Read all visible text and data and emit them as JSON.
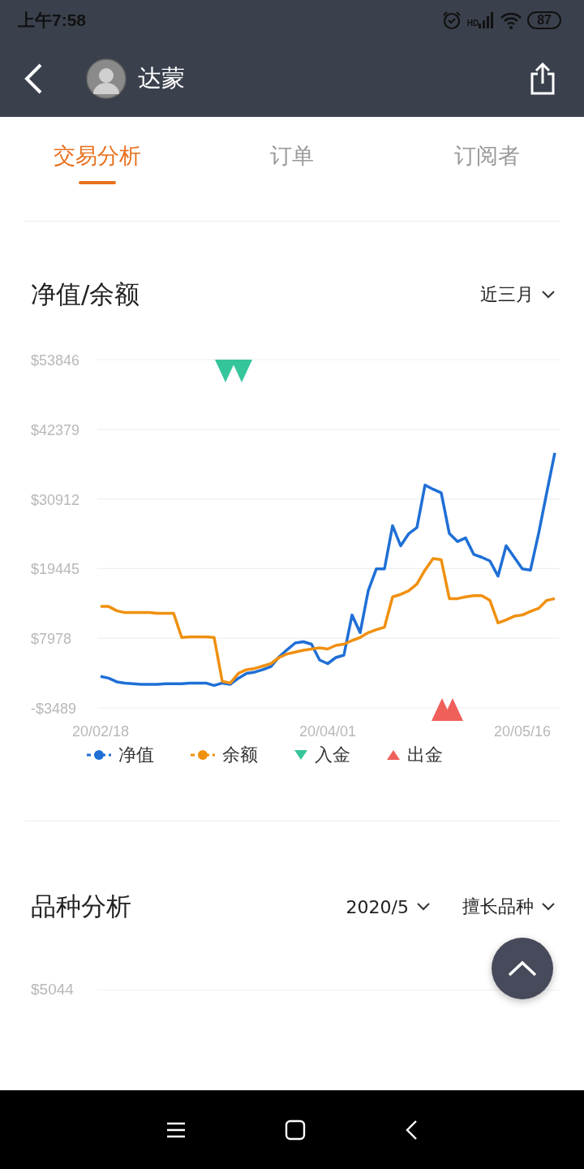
{
  "status_bar": {
    "time": "上午7:58",
    "signal_badge": "HD",
    "battery": "87"
  },
  "header": {
    "title": "达蒙"
  },
  "tabs": [
    {
      "label": "交易分析",
      "selected": true
    },
    {
      "label": "订单",
      "selected": false
    },
    {
      "label": "订阅者",
      "selected": false
    }
  ],
  "equity_section": {
    "title": "净值/余额",
    "period": "近三月",
    "chart_data": {
      "type": "line",
      "categories": [
        "20/02/18",
        null,
        null,
        null,
        null,
        null,
        null,
        null,
        null,
        null,
        null,
        null,
        null,
        null,
        null,
        null,
        null,
        null,
        null,
        null,
        null,
        null,
        null,
        null,
        null,
        null,
        null,
        null,
        "20/04/01",
        null,
        null,
        null,
        null,
        null,
        null,
        null,
        null,
        null,
        null,
        null,
        null,
        null,
        null,
        null,
        null,
        null,
        null,
        null,
        null,
        null,
        null,
        null,
        "20/05/16",
        null,
        null,
        null,
        null
      ],
      "ylim": [
        -3489,
        53846
      ],
      "yticks": [
        {
          "value": 53846,
          "label": "$53846"
        },
        {
          "value": 42379,
          "label": "$42379"
        },
        {
          "value": 30912,
          "label": "$30912"
        },
        {
          "value": 19445,
          "label": "$19445"
        },
        {
          "value": 7978,
          "label": "$7978"
        },
        {
          "value": -3489,
          "label": "-$3489"
        }
      ],
      "series": [
        {
          "name": "净值",
          "color": "#1f6fd6",
          "values": [
            1700,
            1400,
            800,
            600,
            500,
            400,
            400,
            400,
            500,
            500,
            500,
            600,
            600,
            600,
            200,
            600,
            400,
            1400,
            2200,
            2400,
            2800,
            3300,
            4900,
            6100,
            7200,
            7400,
            7000,
            4400,
            3800,
            4800,
            5200,
            11800,
            8900,
            15800,
            19400,
            19400,
            26500,
            23200,
            25200,
            26200,
            33200,
            32500,
            31900,
            25200,
            23900,
            24500,
            21800,
            21300,
            20700,
            18200,
            23200,
            21300,
            19400,
            19200,
            25200,
            31900,
            38500
          ]
        },
        {
          "name": "余额",
          "color": "#f0900f",
          "values": [
            13200,
            13200,
            12500,
            12200,
            12200,
            12200,
            12200,
            12100,
            12100,
            12100,
            8100,
            8200,
            8200,
            8200,
            8100,
            900,
            600,
            2200,
            2800,
            3000,
            3400,
            3800,
            4800,
            5400,
            5700,
            6000,
            6200,
            6400,
            6200,
            6800,
            7000,
            7600,
            8100,
            8900,
            9400,
            9800,
            14800,
            15200,
            15800,
            16900,
            19200,
            21100,
            20900,
            14500,
            14500,
            14800,
            15000,
            15000,
            14200,
            10500,
            11000,
            11600,
            11800,
            12400,
            12900,
            14200,
            14500
          ]
        }
      ],
      "grid": true
    },
    "events": [
      {
        "kind": "deposit"
      },
      {
        "kind": "deposit"
      },
      {
        "kind": "withdrawal"
      },
      {
        "kind": "withdrawal"
      }
    ],
    "marker_legend": [
      {
        "kind": "deposit",
        "label": "入金",
        "color": "#35c59a"
      },
      {
        "kind": "withdrawal",
        "label": "出金",
        "color": "#f0605a"
      }
    ]
  },
  "symbol_section": {
    "title": "品种分析",
    "filters": [
      "2020/5",
      "擅长品种"
    ],
    "axis_labels": [
      "$5044"
    ]
  }
}
